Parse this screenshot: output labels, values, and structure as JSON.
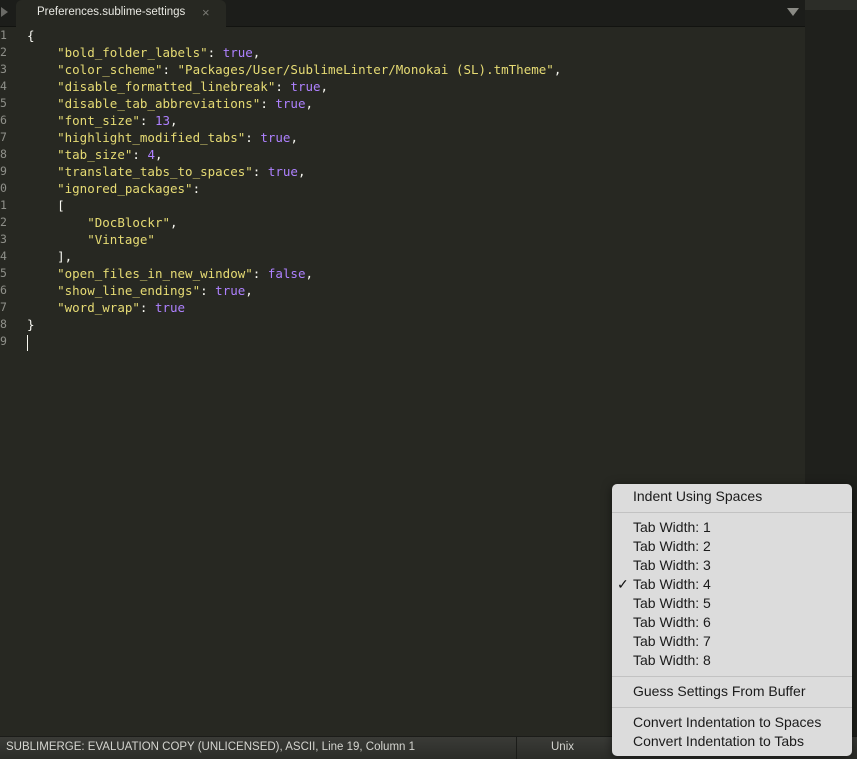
{
  "tab": {
    "title": "Preferences.sublime-settings",
    "close_glyph": "×"
  },
  "editor": {
    "line_numbers": [
      "1",
      "2",
      "3",
      "4",
      "5",
      "6",
      "7",
      "8",
      "9",
      "0",
      "1",
      "2",
      "3",
      "4",
      "5",
      "6",
      "7",
      "8",
      "9"
    ],
    "lines": [
      [
        {
          "t": "p",
          "v": "{"
        }
      ],
      [
        {
          "t": "p",
          "v": "    "
        },
        {
          "t": "s",
          "v": "\"bold_folder_labels\""
        },
        {
          "t": "p",
          "v": ": "
        },
        {
          "t": "kw",
          "v": "true"
        },
        {
          "t": "p",
          "v": ","
        }
      ],
      [
        {
          "t": "p",
          "v": "    "
        },
        {
          "t": "s",
          "v": "\"color_scheme\""
        },
        {
          "t": "p",
          "v": ": "
        },
        {
          "t": "s",
          "v": "\"Packages/User/SublimeLinter/Monokai (SL).tmTheme\""
        },
        {
          "t": "p",
          "v": ","
        }
      ],
      [
        {
          "t": "p",
          "v": "    "
        },
        {
          "t": "s",
          "v": "\"disable_formatted_linebreak\""
        },
        {
          "t": "p",
          "v": ": "
        },
        {
          "t": "kw",
          "v": "true"
        },
        {
          "t": "p",
          "v": ","
        }
      ],
      [
        {
          "t": "p",
          "v": "    "
        },
        {
          "t": "s",
          "v": "\"disable_tab_abbreviations\""
        },
        {
          "t": "p",
          "v": ": "
        },
        {
          "t": "kw",
          "v": "true"
        },
        {
          "t": "p",
          "v": ","
        }
      ],
      [
        {
          "t": "p",
          "v": "    "
        },
        {
          "t": "s",
          "v": "\"font_size\""
        },
        {
          "t": "p",
          "v": ": "
        },
        {
          "t": "kw",
          "v": "13"
        },
        {
          "t": "p",
          "v": ","
        }
      ],
      [
        {
          "t": "p",
          "v": "    "
        },
        {
          "t": "s",
          "v": "\"highlight_modified_tabs\""
        },
        {
          "t": "p",
          "v": ": "
        },
        {
          "t": "kw",
          "v": "true"
        },
        {
          "t": "p",
          "v": ","
        }
      ],
      [
        {
          "t": "p",
          "v": "    "
        },
        {
          "t": "s",
          "v": "\"tab_size\""
        },
        {
          "t": "p",
          "v": ": "
        },
        {
          "t": "kw",
          "v": "4"
        },
        {
          "t": "p",
          "v": ","
        }
      ],
      [
        {
          "t": "p",
          "v": "    "
        },
        {
          "t": "s",
          "v": "\"translate_tabs_to_spaces\""
        },
        {
          "t": "p",
          "v": ": "
        },
        {
          "t": "kw",
          "v": "true"
        },
        {
          "t": "p",
          "v": ","
        }
      ],
      [
        {
          "t": "p",
          "v": "    "
        },
        {
          "t": "s",
          "v": "\"ignored_packages\""
        },
        {
          "t": "p",
          "v": ":"
        }
      ],
      [
        {
          "t": "p",
          "v": "    ["
        }
      ],
      [
        {
          "t": "p",
          "v": "        "
        },
        {
          "t": "s",
          "v": "\"DocBlockr\""
        },
        {
          "t": "p",
          "v": ","
        }
      ],
      [
        {
          "t": "p",
          "v": "        "
        },
        {
          "t": "s",
          "v": "\"Vintage\""
        }
      ],
      [
        {
          "t": "p",
          "v": "    ],"
        }
      ],
      [
        {
          "t": "p",
          "v": "    "
        },
        {
          "t": "s",
          "v": "\"open_files_in_new_window\""
        },
        {
          "t": "p",
          "v": ": "
        },
        {
          "t": "kw",
          "v": "false"
        },
        {
          "t": "p",
          "v": ","
        }
      ],
      [
        {
          "t": "p",
          "v": "    "
        },
        {
          "t": "s",
          "v": "\"show_line_endings\""
        },
        {
          "t": "p",
          "v": ": "
        },
        {
          "t": "kw",
          "v": "true"
        },
        {
          "t": "p",
          "v": ","
        }
      ],
      [
        {
          "t": "p",
          "v": "    "
        },
        {
          "t": "s",
          "v": "\"word_wrap\""
        },
        {
          "t": "p",
          "v": ": "
        },
        {
          "t": "kw",
          "v": "true"
        }
      ],
      [
        {
          "t": "p",
          "v": "}"
        }
      ],
      [
        {
          "t": "p",
          "v": ""
        }
      ]
    ],
    "colors": {
      "background": "#272822",
      "string": "#e6db74",
      "constant": "#ae81ff",
      "text": "#f8f8f2"
    }
  },
  "status": {
    "text": "SUBLIMERGE: EVALUATION COPY (UNLICENSED), ASCII, Line 19, Column 1",
    "line_endings": "Unix"
  },
  "menu": {
    "indent_using_spaces": "Indent Using Spaces",
    "tab_widths": [
      {
        "label": "Tab Width: 1",
        "checked": false
      },
      {
        "label": "Tab Width: 2",
        "checked": false
      },
      {
        "label": "Tab Width: 3",
        "checked": false
      },
      {
        "label": "Tab Width: 4",
        "checked": true
      },
      {
        "label": "Tab Width: 5",
        "checked": false
      },
      {
        "label": "Tab Width: 6",
        "checked": false
      },
      {
        "label": "Tab Width: 7",
        "checked": false
      },
      {
        "label": "Tab Width: 8",
        "checked": false
      }
    ],
    "check_glyph": "✓",
    "guess_settings": "Guess Settings From Buffer",
    "convert_to_spaces": "Convert Indentation to Spaces",
    "convert_to_tabs": "Convert Indentation to Tabs"
  }
}
